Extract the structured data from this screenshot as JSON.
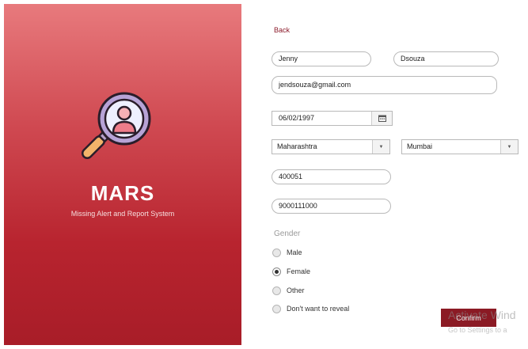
{
  "brand": {
    "title": "MARS",
    "subtitle": "Missing Alert and Report System",
    "logo_icon": "magnifier-person-icon"
  },
  "form": {
    "back_label": "Back",
    "first_name": "Jenny",
    "last_name": "Dsouza",
    "email": "jendsouza@gmail.com",
    "dob": "06/02/1997",
    "state": "Maharashtra",
    "city": "Mumbai",
    "pincode": "400051",
    "phone": "9000111000",
    "gender_label": "Gender",
    "gender_options": [
      "Male",
      "Female",
      "Other",
      "Don't want to reveal"
    ],
    "gender_selected": "Female",
    "confirm_label": "Confirm"
  },
  "watermark": {
    "title": "Activate Wind",
    "subtitle": "Go to Settings to a"
  },
  "colors": {
    "accent": "#8b1a24",
    "panel_top": "#e87a7d",
    "panel_bottom": "#a81d28"
  }
}
